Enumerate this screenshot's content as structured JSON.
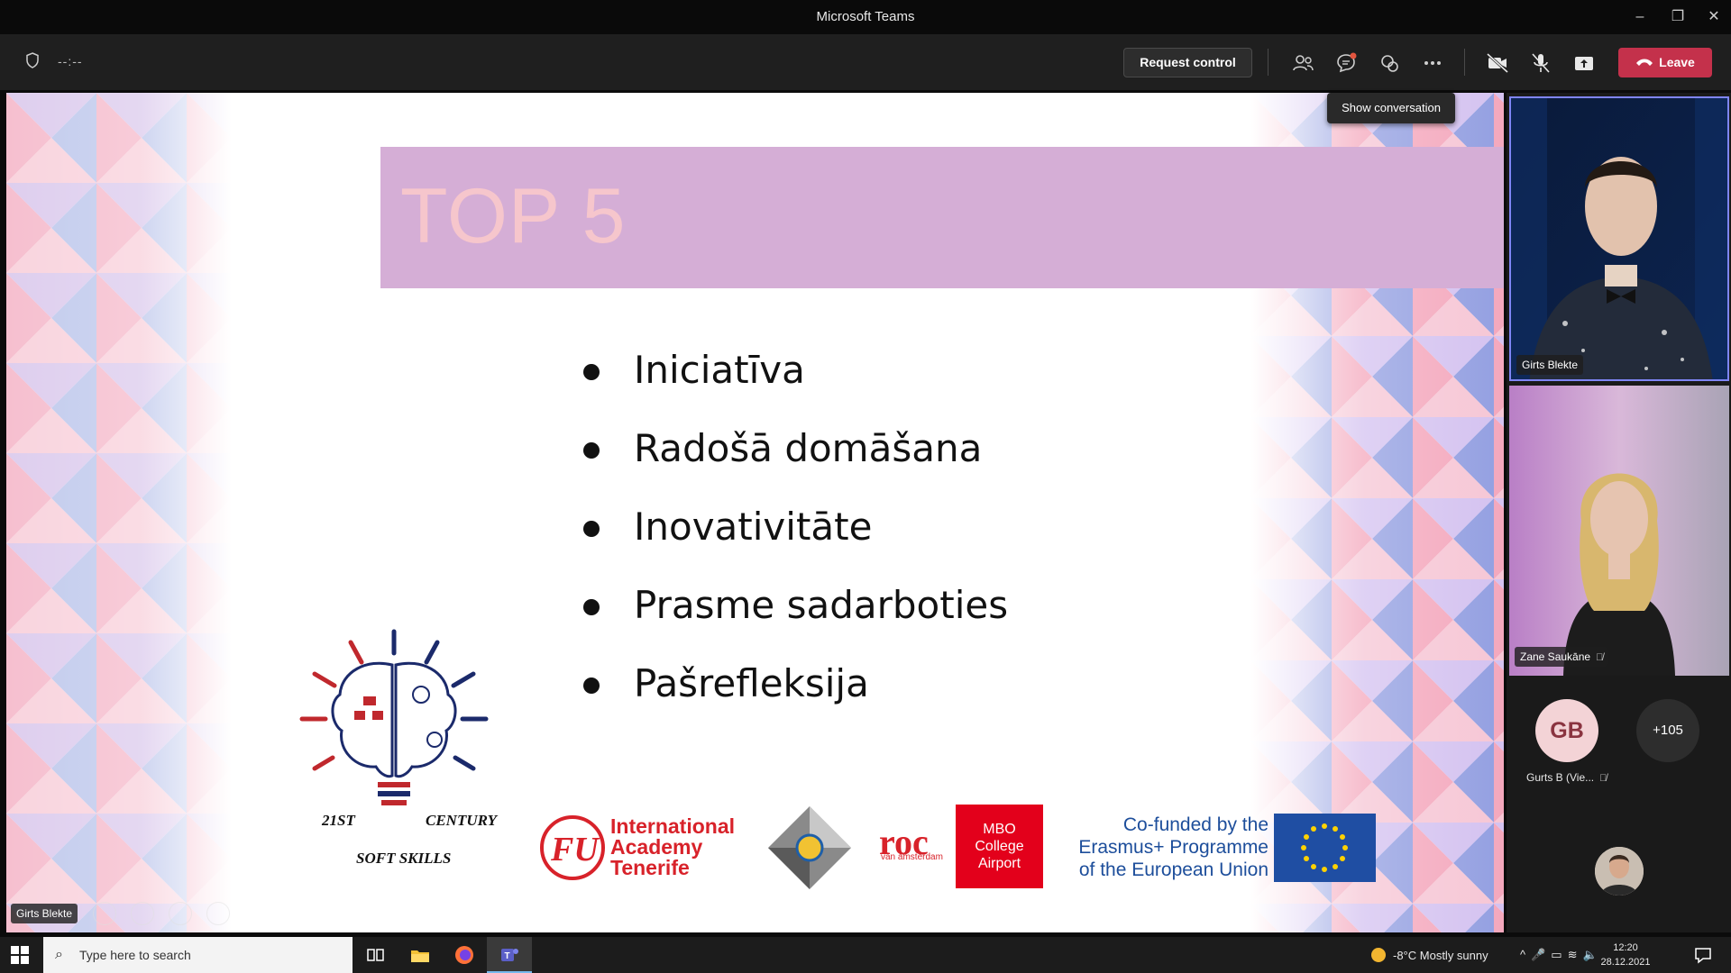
{
  "window": {
    "title": "Microsoft Teams",
    "controls": {
      "minimize": "–",
      "restore": "❐",
      "close": "✕"
    }
  },
  "toolbar": {
    "timer": "--:--",
    "request_control": "Request control",
    "leave": "Leave",
    "tooltip": "Show conversation",
    "icons": [
      "people-icon",
      "chat-icon",
      "reactions-icon",
      "more-icon",
      "camera-off-icon",
      "mic-off-icon",
      "share-icon"
    ]
  },
  "slide": {
    "title": "TOP 5",
    "bullets": [
      "Iniciatīva",
      "Radošā domāšana",
      "Inovativitāte",
      "Prasme sadarboties",
      "Pašrefleksija"
    ],
    "logos": {
      "skills_line1_left": "21ST",
      "skills_line1_right": "CENTURY",
      "skills_line2": "SOFT SKILLS",
      "academy": [
        "International",
        "Academy",
        "Tenerife"
      ],
      "roc": "roc",
      "roc_sub": "van amsterdam",
      "mbo": [
        "MBO",
        "College",
        "Airport"
      ],
      "cofunded": [
        "Co-funded by the",
        "Erasmus+ Programme",
        "of the European Union"
      ]
    },
    "presenter": "Girts Blekte"
  },
  "participants": {
    "video1_name": "Girts Blekte",
    "video2_name": "Zane Saukāne",
    "gb_initials": "GB",
    "gb_name": "Gurts B (Vie...",
    "more_count": "+105"
  },
  "taskbar": {
    "search_placeholder": "Type here to search",
    "weather": "-8°C  Mostly sunny",
    "time": "12:20",
    "date": "28.12.2021"
  },
  "colors": {
    "leave": "#c4314b",
    "title_band": "#d5aed6",
    "title_text": "#f6c6cc",
    "active_speaker_border": "#7f85f5"
  }
}
